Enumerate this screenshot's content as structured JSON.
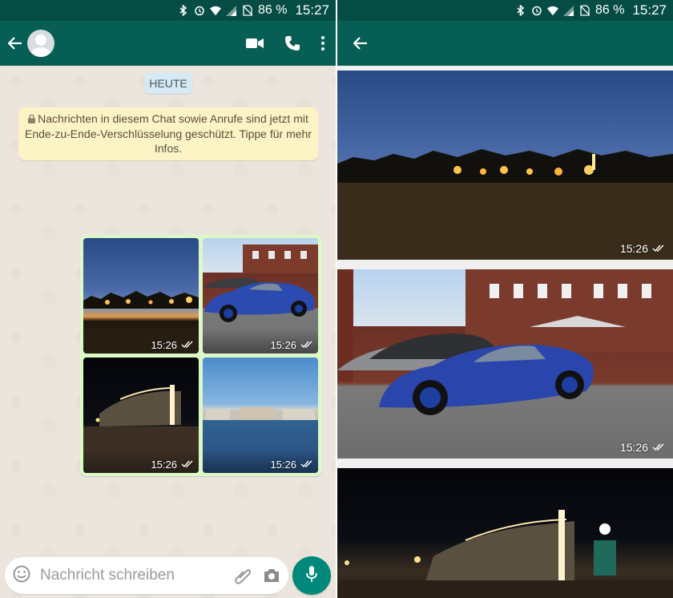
{
  "colors": {
    "status_bar": "#054d44",
    "app_bar": "#075e54",
    "chat_bg": "#ece5dd",
    "outgoing_bubble": "#dcf8c6",
    "encryption_note_bg": "#fdf4c5",
    "date_chip_bg": "#d5eaf5",
    "mic_button": "#00897b"
  },
  "left": {
    "status_bar": {
      "icons": [
        "bluetooth-icon",
        "alarm-icon",
        "wifi-icon",
        "signal-icon",
        "no-sim-icon"
      ],
      "battery": "86 %",
      "time": "15:27"
    },
    "app_bar": {
      "icons": [
        "back-arrow-icon",
        "avatar",
        "video-call-icon",
        "phone-icon",
        "more-vert-icon"
      ]
    },
    "chat": {
      "date_chip": "HEUTE",
      "encryption_note": "Nachrichten in diesem Chat sowie Anrufe sind jetzt mit Ende-zu-Ende-Verschlüsselung geschützt. Tippe für mehr Infos.",
      "photo_message": {
        "thumbnails": [
          {
            "subject": "sunset-field",
            "time": "15:26",
            "status_icon": "double-check-icon"
          },
          {
            "subject": "blue-sports-car",
            "time": "15:26",
            "status_icon": "double-check-icon"
          },
          {
            "subject": "night-building",
            "time": "15:26",
            "status_icon": "double-check-icon"
          },
          {
            "subject": "waterfront",
            "time": "15:26",
            "status_icon": "double-check-icon"
          }
        ]
      }
    },
    "input": {
      "placeholder": "Nachricht schreiben",
      "icons": [
        "emoji-icon",
        "attach-icon",
        "camera-icon",
        "mic-icon"
      ]
    }
  },
  "right": {
    "status_bar": {
      "battery": "86 %",
      "time": "15:27"
    },
    "app_bar": {
      "icons": [
        "back-arrow-icon"
      ]
    },
    "photos": [
      {
        "subject": "sunset-field",
        "time": "15:26"
      },
      {
        "subject": "blue-sports-car",
        "time": "15:26"
      },
      {
        "subject": "night-building",
        "time": ""
      }
    ]
  }
}
